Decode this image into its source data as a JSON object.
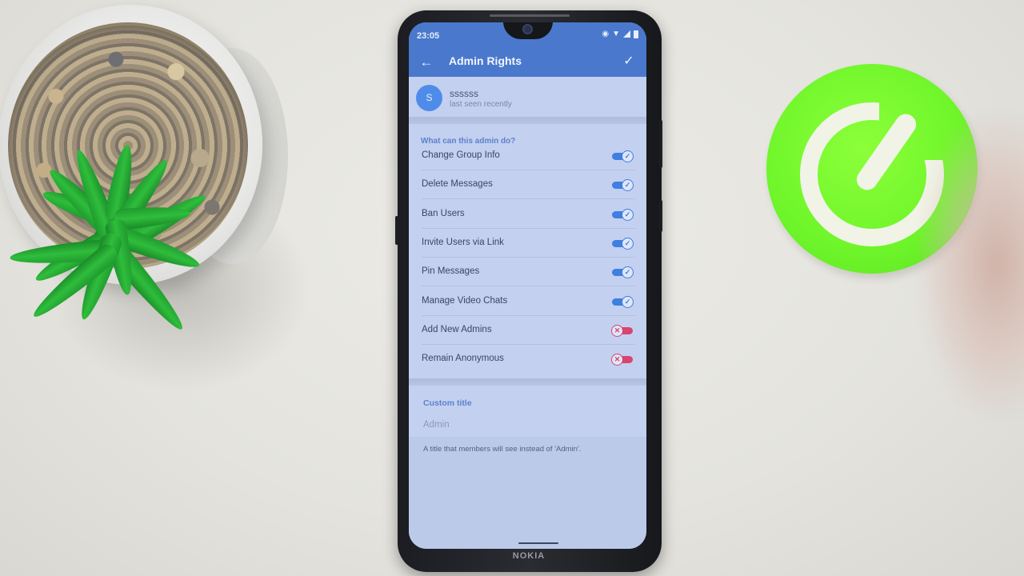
{
  "status_bar": {
    "time": "23:05",
    "icons": [
      "eye-comfort-icon",
      "wifi-icon",
      "signal-icon",
      "battery-icon"
    ]
  },
  "app_bar": {
    "title": "Admin Rights",
    "back_icon": "arrow-left-icon",
    "back_glyph": "←",
    "done_icon": "checkmark-icon",
    "done_glyph": "✓"
  },
  "user": {
    "avatar_letter": "S",
    "name": "ssssss",
    "status": "last seen recently",
    "avatar_color": "#4f8cea"
  },
  "rights": {
    "header": "What can this admin do?",
    "items": [
      {
        "label": "Change Group Info",
        "enabled": true
      },
      {
        "label": "Delete Messages",
        "enabled": true
      },
      {
        "label": "Ban Users",
        "enabled": true
      },
      {
        "label": "Invite Users via Link",
        "enabled": true
      },
      {
        "label": "Pin Messages",
        "enabled": true
      },
      {
        "label": "Manage Video Chats",
        "enabled": true
      },
      {
        "label": "Add New Admins",
        "enabled": false
      },
      {
        "label": "Remain Anonymous",
        "enabled": false
      }
    ],
    "on_glyph": "✓",
    "off_glyph": "✕"
  },
  "custom_title": {
    "label": "Custom title",
    "value": "",
    "placeholder": "Admin",
    "hint": "A title that members will see instead of 'Admin'."
  },
  "device": {
    "brand": "NOKIA"
  },
  "colors": {
    "app_bar": "#4a78cc",
    "accent_on": "#3f7fe0",
    "accent_off": "#d8456f",
    "section_header": "#5c82cc",
    "screen_bg": "#c3d0ef"
  }
}
